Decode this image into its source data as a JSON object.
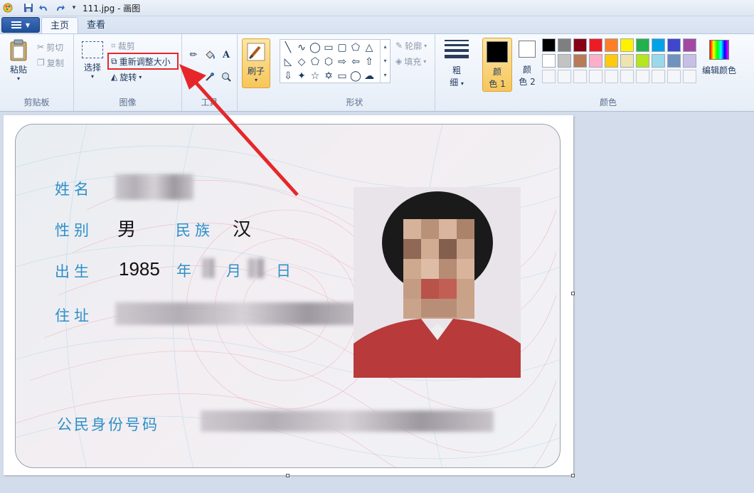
{
  "window": {
    "title": "111.jpg - 画图"
  },
  "tabs": [
    {
      "label": "主页",
      "active": true
    },
    {
      "label": "查看",
      "active": false
    }
  ],
  "ribbon": {
    "clipboard": {
      "paste": "粘贴",
      "cut": "剪切",
      "copy": "复制",
      "group": "剪贴板"
    },
    "image": {
      "select": "选择",
      "crop": "裁剪",
      "resize": "重新调整大小",
      "rotate": "旋转",
      "group": "图像"
    },
    "tools": {
      "group": "工具"
    },
    "brushes": {
      "label": "刷子"
    },
    "shapes": {
      "outline": "轮廓",
      "fill": "填充",
      "group": "形状"
    },
    "size": {
      "label_top": "粗",
      "label_bottom": "细"
    },
    "colors": {
      "color1_top": "颜",
      "color1_bottom": "色 1",
      "color2_top": "颜",
      "color2_bottom": "色 2",
      "edit_colors": "编辑颜色",
      "group": "颜色",
      "palette_row1": [
        "#000000",
        "#7f7f7f",
        "#880015",
        "#ed1c24",
        "#ff7f27",
        "#fff200",
        "#22b14c",
        "#00a2e8",
        "#3f48cc",
        "#a349a4"
      ],
      "palette_row2": [
        "#ffffff",
        "#c3c3c3",
        "#b97a57",
        "#ffaec9",
        "#ffc90e",
        "#efe4b0",
        "#b5e61d",
        "#99d9ea",
        "#7092be",
        "#c8bfe7"
      ]
    }
  },
  "id_card": {
    "name_label": "姓名",
    "sex_label": "性别",
    "sex_value": "男",
    "ethnic_label": "民族",
    "ethnic_value": "汉",
    "birth_label": "出生",
    "birth_year": "1985",
    "year_char": "年",
    "month_char": "月",
    "day_char": "日",
    "address_label": "住址",
    "id_label": "公民身份号码"
  },
  "accent_colors": {
    "highlight": "#e5272a",
    "card_label_blue": "#2e8fc9"
  }
}
